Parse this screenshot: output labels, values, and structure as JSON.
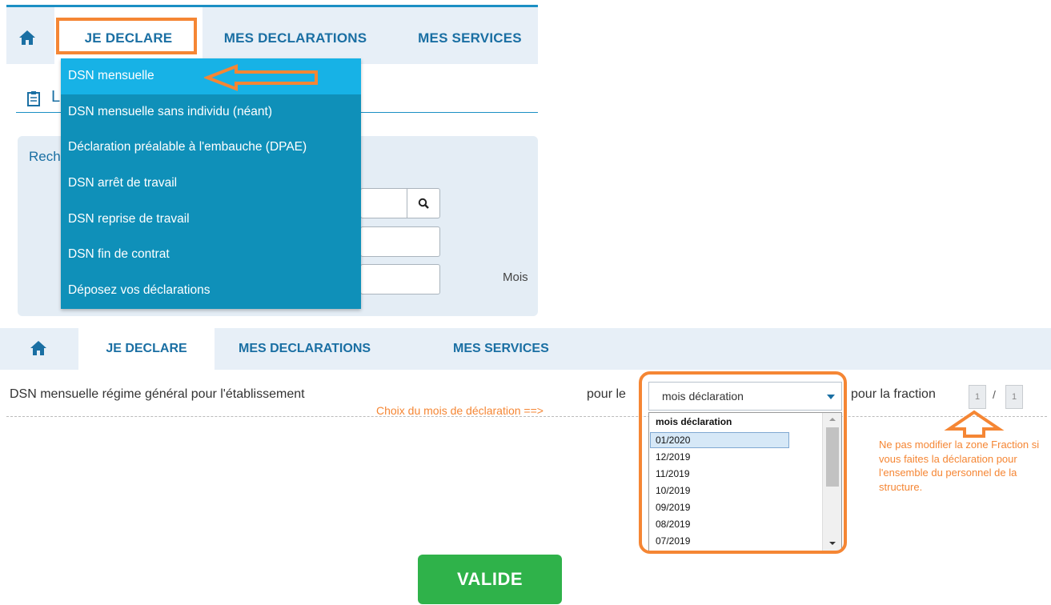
{
  "top": {
    "nav": {
      "tabs": [
        {
          "label": "JE DECLARE"
        },
        {
          "label": "MES DECLARATIONS"
        },
        {
          "label": "MES SERVICES"
        }
      ]
    },
    "page_title": "L",
    "search_label": "Rech",
    "mois_label": "Mois",
    "menu": {
      "items": [
        {
          "label": "DSN mensuelle"
        },
        {
          "label": "DSN mensuelle sans individu (néant)"
        },
        {
          "label": "Déclaration préalable à l'embauche (DPAE)"
        },
        {
          "label": "DSN arrêt de travail"
        },
        {
          "label": "DSN reprise de travail"
        },
        {
          "label": "DSN fin de contrat"
        },
        {
          "label": "Déposez vos déclarations"
        }
      ]
    }
  },
  "bottom": {
    "nav": {
      "tabs": [
        {
          "label": "JE DECLARE"
        },
        {
          "label": "MES DECLARATIONS"
        },
        {
          "label": "MES SERVICES"
        }
      ]
    },
    "dsn_text": "DSN mensuelle régime général pour l'établissement",
    "pour_le": "pour le",
    "pour_fraction": "pour la fraction",
    "fraction": {
      "value": "1",
      "sep": "/",
      "total": "1"
    },
    "select": {
      "value": "mois déclaration",
      "options": [
        "mois déclaration",
        "01/2020",
        "12/2019",
        "11/2019",
        "10/2019",
        "09/2019",
        "08/2019",
        "07/2019"
      ]
    },
    "annotation_choix": "Choix du mois de déclaration ==>",
    "annotation_note": "Ne pas modifier la zone Fraction si vous faites la déclaration pour l'ensemble du personnel de la structure.",
    "valide_label": "VALIDE"
  },
  "colors": {
    "accent_blue": "#1a6fa3",
    "menu_bg": "#0f90b9",
    "menu_active": "#17b2e6",
    "highlight_orange": "#f58634",
    "valide_green": "#2fb24a"
  }
}
